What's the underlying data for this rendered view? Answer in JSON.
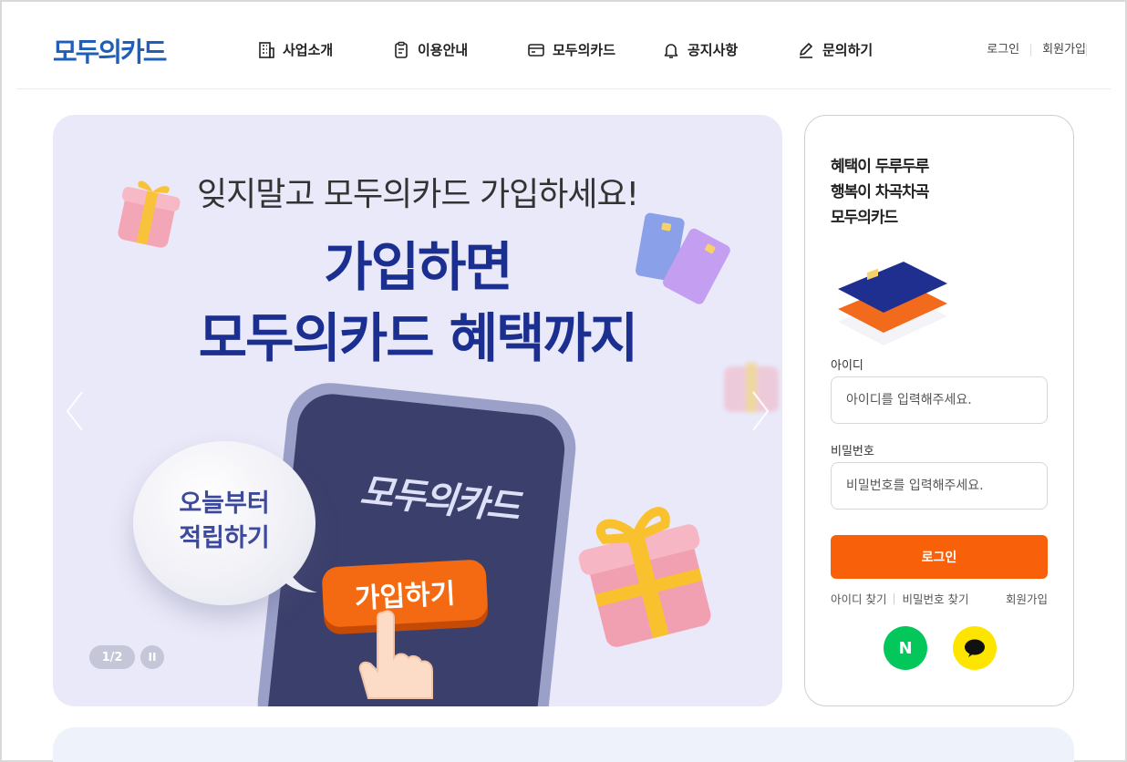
{
  "header": {
    "logo": "모두의카드",
    "nav": [
      {
        "label": "사업소개",
        "icon": "building-icon"
      },
      {
        "label": "이용안내",
        "icon": "clipboard-icon"
      },
      {
        "label": "모두의카드",
        "icon": "card-icon"
      },
      {
        "label": "공지사항",
        "icon": "bell-icon"
      },
      {
        "label": "문의하기",
        "icon": "pencil-icon"
      }
    ],
    "util": {
      "login": "로그인",
      "signup": "회원가입"
    }
  },
  "banner": {
    "subtitle": "잊지말고 모두의카드 가입하세요!",
    "title_line1": "가입하면",
    "title_line2": "모두의카드 혜택까지",
    "phone_logo": "모두의카드",
    "join_button": "가입하기",
    "bubble_line1": "오늘부터",
    "bubble_line2": "적립하기",
    "pager": "1/2",
    "pause": "II",
    "colors": {
      "background": "#e9e9f9",
      "title": "#1a2f8f",
      "button": "#f46a12"
    }
  },
  "login": {
    "slogan_line1": "혜택이 두루두루",
    "slogan_line2": "행복이 차곡차곡",
    "slogan_line3": "모두의카드",
    "id_label": "아이디",
    "id_placeholder": "아이디를 입력해주세요.",
    "pw_label": "비밀번호",
    "pw_placeholder": "비밀번호를 입력해주세요.",
    "login_button": "로그인",
    "find_id": "아이디 찾기",
    "find_pw": "비밀번호 찾기",
    "signup": "회원가입",
    "naver": "N",
    "colors": {
      "accent": "#f9600a",
      "naver": "#03c75a",
      "kakao": "#fee500"
    }
  }
}
